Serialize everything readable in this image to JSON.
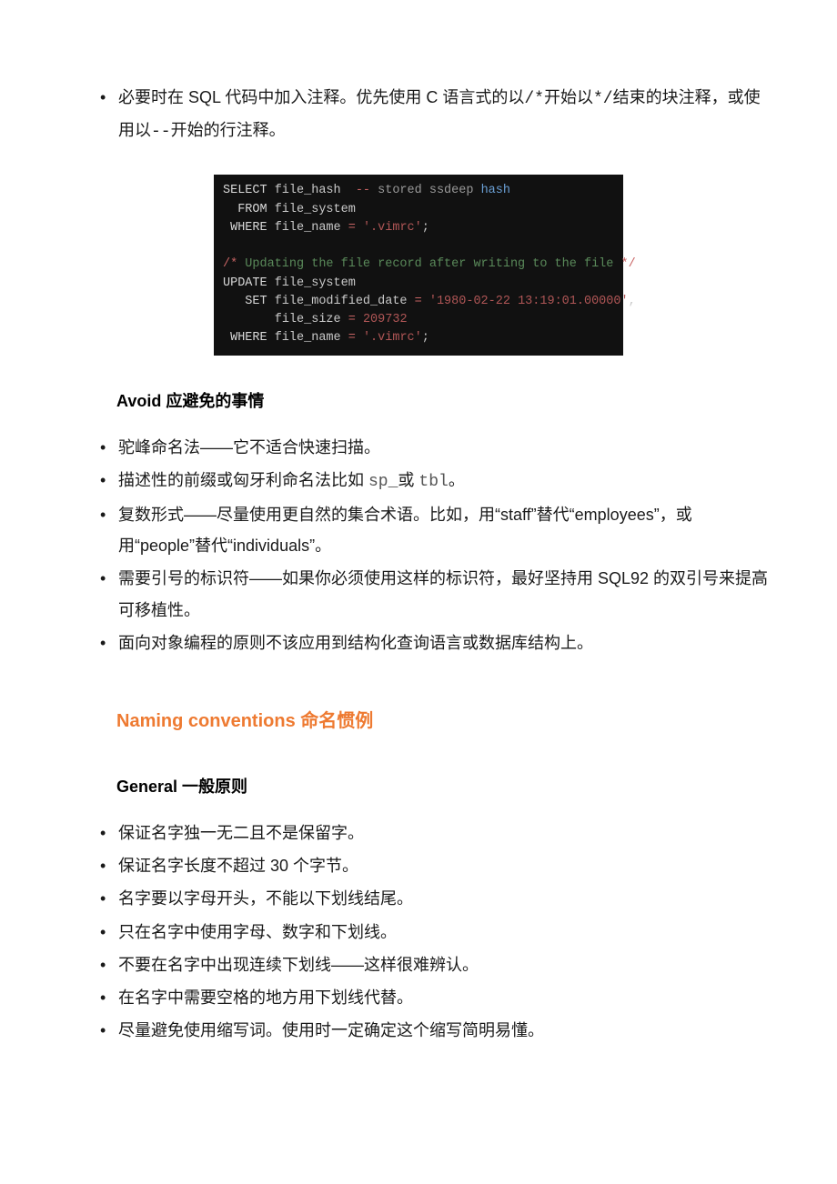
{
  "section_comments": {
    "bullet1_part1": "必要时在 SQL 代码中加入注释。优先使用 C 语言式的以",
    "bullet1_code1": "/*",
    "bullet1_part2": "开始以",
    "bullet1_code2": "*/",
    "bullet1_part3": "结束的块注释，或使用以",
    "bullet1_code3": "--",
    "bullet1_part4": "开始的行注释。"
  },
  "code_block": {
    "line1_select": "SELECT",
    "line1_col": " file_hash  ",
    "line1_dash": "--",
    "line1_text": " stored ssdeep ",
    "line1_hash": "hash",
    "line2_from": "  FROM",
    "line2_tbl": " file_system",
    "line3_where": " WHERE",
    "line3_col": " file_name ",
    "line3_eq": "=",
    "line3_str": " '.vimrc'",
    "line3_semi": ";",
    "blank": "",
    "line5_com_open": "/*",
    "line5_com_text": " Updating the file record after writing to the file ",
    "line5_com_close": "*/",
    "line6_update": "UPDATE",
    "line6_tbl": " file_system",
    "line7_set": "   SET",
    "line7_col": " file_modified_date ",
    "line7_eq": "=",
    "line7_str": " '1980-02-22 13:19:01.00000'",
    "line7_comma": ",",
    "line8_spaces": "       ",
    "line8_col": "file_size ",
    "line8_eq": "=",
    "line8_num": " 209732",
    "line9_where": " WHERE",
    "line9_col": " file_name ",
    "line9_eq": "=",
    "line9_str": " '.vimrc'",
    "line9_semi": ";"
  },
  "avoid_heading": "Avoid 应避免的事情",
  "avoid_list": {
    "item1": "驼峰命名法——它不适合快速扫描。",
    "item2_p1": "描述性的前缀或匈牙利命名法比如 ",
    "item2_c1": "sp_",
    "item2_p2": "或 ",
    "item2_c2": "tbl",
    "item2_p3": "。",
    "item3": "复数形式——尽量使用更自然的集合术语。比如，用“staff”替代“employees”，或用“people”替代“individuals”。",
    "item4": "需要引号的标识符——如果你必须使用这样的标识符，最好坚持用 SQL92 的双引号来提高可移植性。",
    "item5": "面向对象编程的原则不该应用到结构化查询语言或数据库结构上。"
  },
  "naming_heading": "Naming conventions 命名惯例",
  "general_heading": "General 一般原则",
  "general_list": {
    "item1": "保证名字独一无二且不是保留字。",
    "item2": "保证名字长度不超过 30 个字节。",
    "item3": "名字要以字母开头，不能以下划线结尾。",
    "item4": "只在名字中使用字母、数字和下划线。",
    "item5": "不要在名字中出现连续下划线——这样很难辨认。",
    "item6": "在名字中需要空格的地方用下划线代替。",
    "item7": "尽量避免使用缩写词。使用时一定确定这个缩写简明易懂。"
  }
}
